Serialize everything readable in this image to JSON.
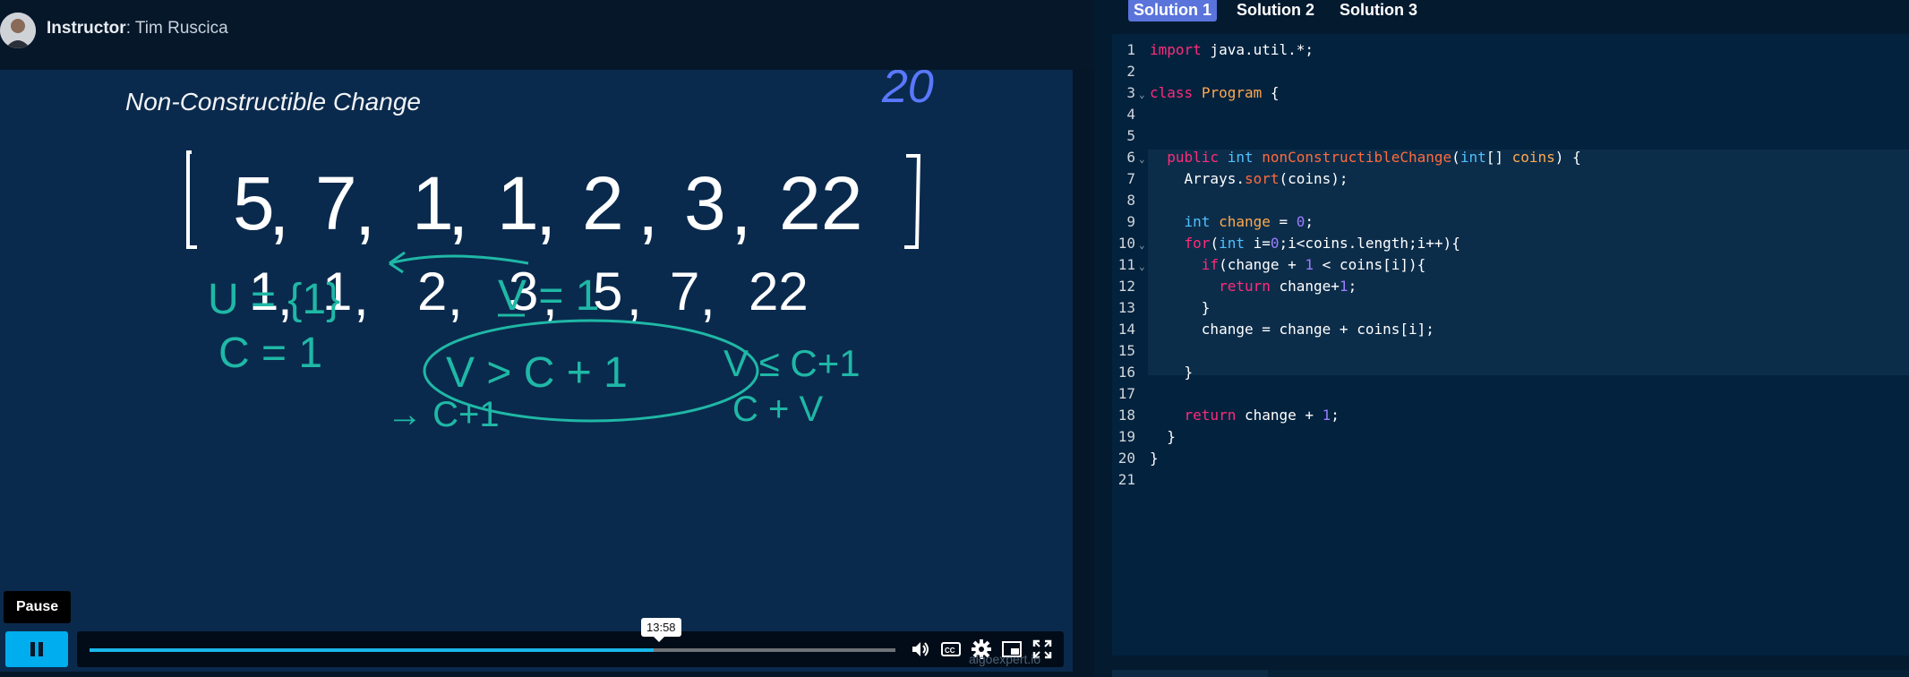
{
  "instructor": {
    "label": "Instructor",
    "name": ": Tim Ruscica"
  },
  "video": {
    "title": "Non-Constructible Change",
    "counter": "20",
    "array_top": [
      "5",
      "7",
      "1",
      "1",
      "2",
      "3",
      "22"
    ],
    "array_sorted": [
      "1",
      "1",
      "2",
      "3",
      "5",
      "7",
      "22"
    ],
    "notes": {
      "u_set": "U = {1}",
      "v_eq": "V = 1",
      "c_eq": "C = 1",
      "inequality": "V > C + 1",
      "leq": "V ≤ C+1",
      "c_plus_1": "→ C+1",
      "c_plus_v": "C + V"
    },
    "pause_tooltip": "Pause",
    "time_tooltip": "13:58",
    "progress_fraction": 0.7,
    "watermark": "algoexpert.io"
  },
  "tabs": [
    {
      "label": "Solution 1",
      "active": true
    },
    {
      "label": "Solution 2",
      "active": false
    },
    {
      "label": "Solution 3",
      "active": false
    }
  ],
  "code_lines": [
    "import java.util.*;",
    "",
    "class Program {",
    "",
    "",
    "  public int nonConstructibleChange(int[] coins) {",
    "    Arrays.sort(coins);",
    "",
    "    int change = 0;",
    "    for(int i=0;i<coins.length;i++){",
    "      if(change + 1 < coins[i]){",
    "        return change+1;",
    "      }",
    "      change = change + coins[i];",
    "",
    "    }",
    "",
    "    return change + 1;",
    "  }",
    "}",
    ""
  ],
  "colors": {
    "accent": "#00adef",
    "tab_active": "#5b74db",
    "chalk_teal": "#1fb8a6",
    "chalk_blue": "#5a78ff"
  },
  "icons": [
    "pause-icon",
    "volume-icon",
    "captions-icon",
    "settings-icon",
    "pip-icon",
    "fullscreen-icon",
    "fold-arrow-icon"
  ]
}
